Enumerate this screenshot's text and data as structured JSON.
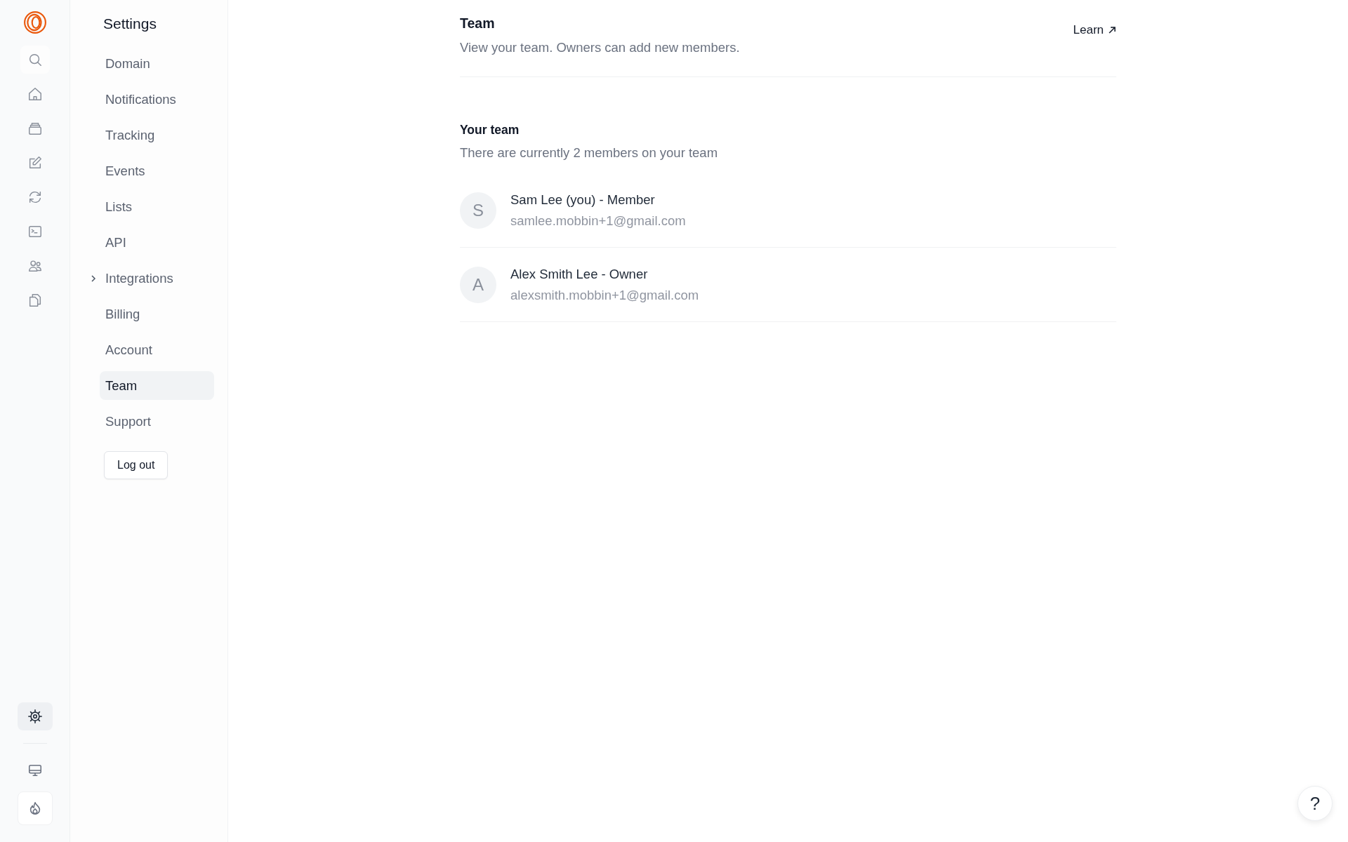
{
  "rail": {
    "top": [
      {
        "selected": false
      },
      {
        "selected": false
      },
      {
        "selected": false
      },
      {
        "selected": false
      },
      {
        "selected": false
      },
      {
        "selected": false
      },
      {
        "selected": false
      },
      {
        "selected": false
      }
    ],
    "bottom": [
      {
        "selected": true
      },
      {
        "selected": false
      },
      {
        "selected": false
      }
    ]
  },
  "sidebar": {
    "title": "Settings",
    "items": [
      {
        "label": "Domain",
        "kind": "link",
        "selected": false
      },
      {
        "label": "Notifications",
        "kind": "link",
        "selected": false
      },
      {
        "label": "Tracking",
        "kind": "link",
        "selected": false
      },
      {
        "label": "Events",
        "kind": "link",
        "selected": false
      },
      {
        "label": "Lists",
        "kind": "link",
        "selected": false
      },
      {
        "label": "API",
        "kind": "link",
        "selected": false
      },
      {
        "label": "Integrations",
        "kind": "group",
        "expanded": false,
        "selected": false
      },
      {
        "label": "Billing",
        "kind": "link",
        "selected": false
      },
      {
        "label": "Account",
        "kind": "link",
        "selected": false
      },
      {
        "label": "Team",
        "kind": "link",
        "selected": true
      },
      {
        "label": "Support",
        "kind": "link",
        "selected": false
      }
    ],
    "logout": "Log out"
  },
  "header": {
    "title": "Team",
    "subtitle": "View your team. Owners can add new members.",
    "learn": "Learn"
  },
  "team": {
    "title": "Your team",
    "subtitle": "There are currently 2 members on your team",
    "members": [
      {
        "initial": "S",
        "name": "Sam Lee (you) - Member",
        "email": "samlee.mobbin+1@gmail.com"
      },
      {
        "initial": "A",
        "name": "Alex Smith Lee - Owner",
        "email": "alexsmith.mobbin+1@gmail.com"
      }
    ]
  },
  "help": "?"
}
